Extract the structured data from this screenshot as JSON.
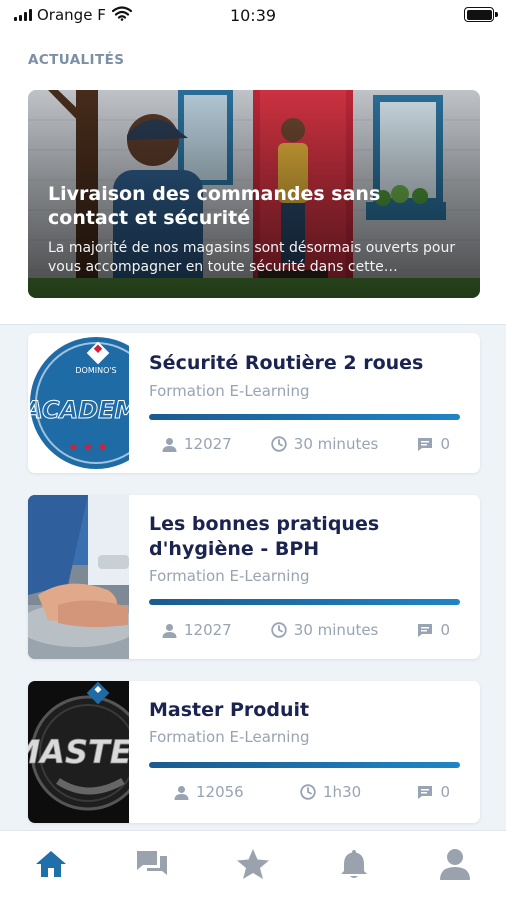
{
  "status_bar": {
    "carrier": "Orange F",
    "time": "10:39",
    "signal_icon": "signal-bars-icon",
    "wifi_icon": "wifi-icon",
    "battery_icon": "battery-icon"
  },
  "news": {
    "section_title": "ACTUALITÉS",
    "hero": {
      "title": "Livraison des commandes sans contact et sécurité",
      "description": "La majorité de nos magasins sont désormais ouverts pour vous accompagner en toute sécurité dans cette…"
    }
  },
  "courses": [
    {
      "title": "Sécurité Routière 2 roues",
      "subtitle": "Formation E-Learning",
      "participants": "12027",
      "duration": "30 minutes",
      "comments": "0",
      "progress": 1.0,
      "thumb_text": "ACADEMY",
      "thumb_brand": "DOMINO'S"
    },
    {
      "title": "Les bonnes pratiques d'hygiène - BPH",
      "subtitle": "Formation E-Learning",
      "participants": "12027",
      "duration": "30 minutes",
      "comments": "0",
      "progress": 1.0
    },
    {
      "title": "Master Produit",
      "subtitle": "Formation E-Learning",
      "participants": "12056",
      "duration": "1h30",
      "comments": "0",
      "progress": 1.0,
      "thumb_text": "MASTE"
    }
  ],
  "tab_bar": {
    "items": [
      {
        "icon": "home-icon",
        "active": true
      },
      {
        "icon": "chat-icon",
        "active": false
      },
      {
        "icon": "star-icon",
        "active": false
      },
      {
        "icon": "bell-icon",
        "active": false
      },
      {
        "icon": "profile-icon",
        "active": false
      }
    ]
  },
  "colors": {
    "accent": "#1f6fa8",
    "title": "#1b2450",
    "muted": "#98a3b3",
    "section_title": "#7d8fa6",
    "list_background": "#eef3f8",
    "tab_inactive": "#9aa3ad"
  }
}
